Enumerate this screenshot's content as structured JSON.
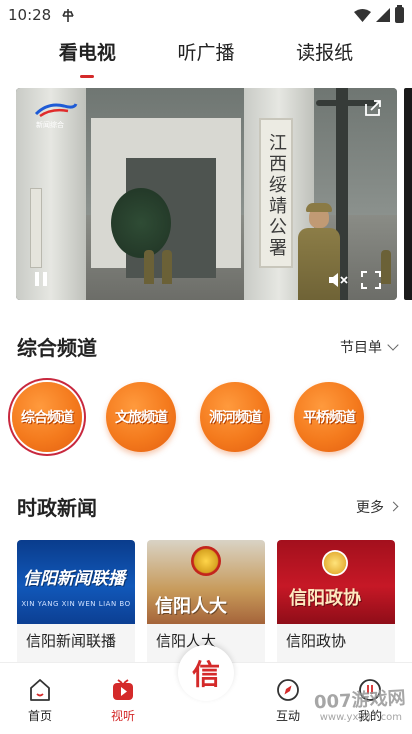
{
  "status_bar": {
    "time": "10:28",
    "app_icon": "signal-tower-icon"
  },
  "top_tabs": [
    {
      "label": "看电视",
      "active": true
    },
    {
      "label": "听广播",
      "active": false
    },
    {
      "label": "读报纸",
      "active": false
    }
  ],
  "video": {
    "logo_text": "新闻综合",
    "sign_text": "江西绥靖公署",
    "playing": true
  },
  "channels_section": {
    "title": "综合频道",
    "link_label": "节目单",
    "channels": [
      {
        "label": "综合频道",
        "selected": true
      },
      {
        "label": "文旅频道",
        "selected": false
      },
      {
        "label": "浉河频道",
        "selected": false
      },
      {
        "label": "平桥频道",
        "selected": false
      }
    ]
  },
  "news_section": {
    "title": "时政新闻",
    "link_label": "更多",
    "cards": [
      {
        "label": "信阳新闻联播",
        "thumb_title": "信阳新闻联播",
        "thumb_sub": "XIN YANG XIN WEN LIAN BO"
      },
      {
        "label": "信阳人大",
        "thumb_title": "信阳人大"
      },
      {
        "label": "信阳政协",
        "thumb_title": "信阳政协"
      }
    ]
  },
  "bottom_nav": {
    "items": [
      {
        "label": "首页",
        "icon": "home-icon",
        "active": false
      },
      {
        "label": "视听",
        "icon": "play-video-icon",
        "active": true
      },
      {
        "label": "互动",
        "icon": "compass-icon",
        "active": false
      },
      {
        "label": "我的",
        "icon": "user-icon",
        "active": false
      }
    ],
    "center_label": "信"
  },
  "watermark": {
    "text": "007游戏网",
    "url": "www.yx007.com"
  },
  "colors": {
    "accent": "#d42a2a",
    "channel_orange": "#f47a1d"
  }
}
